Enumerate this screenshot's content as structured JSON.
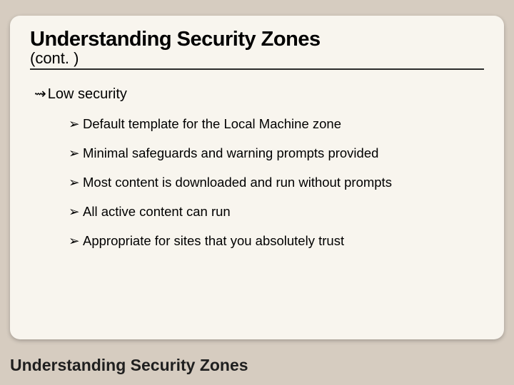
{
  "slide": {
    "title": "Understanding Security Zones",
    "subtitle": "(cont. )",
    "level1": {
      "bullet_glyph": "⇝",
      "text": "Low security"
    },
    "sub_bullet_glyph": "➢",
    "subitems": [
      "Default template for the Local Machine zone",
      "Minimal safeguards and warning prompts provided",
      "Most content is downloaded and run without prompts",
      "All active content can run",
      "Appropriate for sites that you absolutely trust"
    ]
  },
  "footer": "Understanding Security Zones"
}
